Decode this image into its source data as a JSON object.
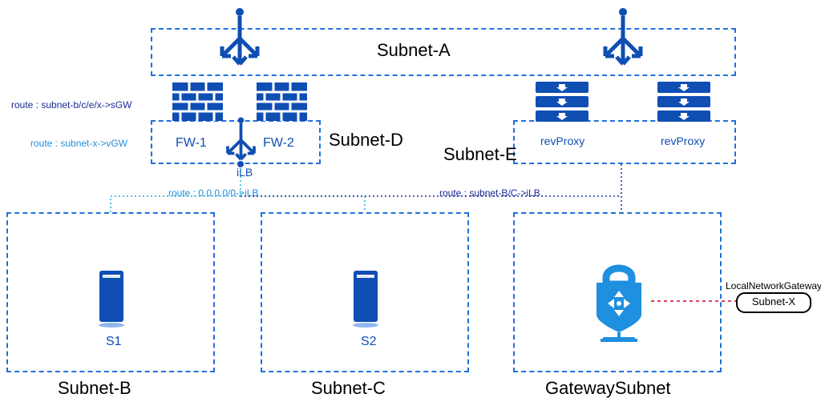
{
  "subnets": {
    "A": "Subnet-A",
    "B": "Subnet-B",
    "C": "Subnet-C",
    "D": "Subnet-D",
    "E": "Subnet-E",
    "Gateway": "GatewaySubnet"
  },
  "firewalls": {
    "fw1": "FW-1",
    "fw2": "FW-2"
  },
  "proxies": {
    "rp1": "revProxy",
    "rp2": "revProxy"
  },
  "ilb": "iLB",
  "servers": {
    "s1": "S1",
    "s2": "S2"
  },
  "routes": {
    "to_sgw": "route : subnet-b/c/e/x->sGW",
    "to_vgw": "route : subnet-x->vGW",
    "default_ilb": "route : 0.0.0.0/0->iLB",
    "bc_ilb": "route : subnet-B/C->iLB"
  },
  "lng": {
    "title": "LocalNetworkGateway",
    "subnet": "Subnet-X"
  }
}
